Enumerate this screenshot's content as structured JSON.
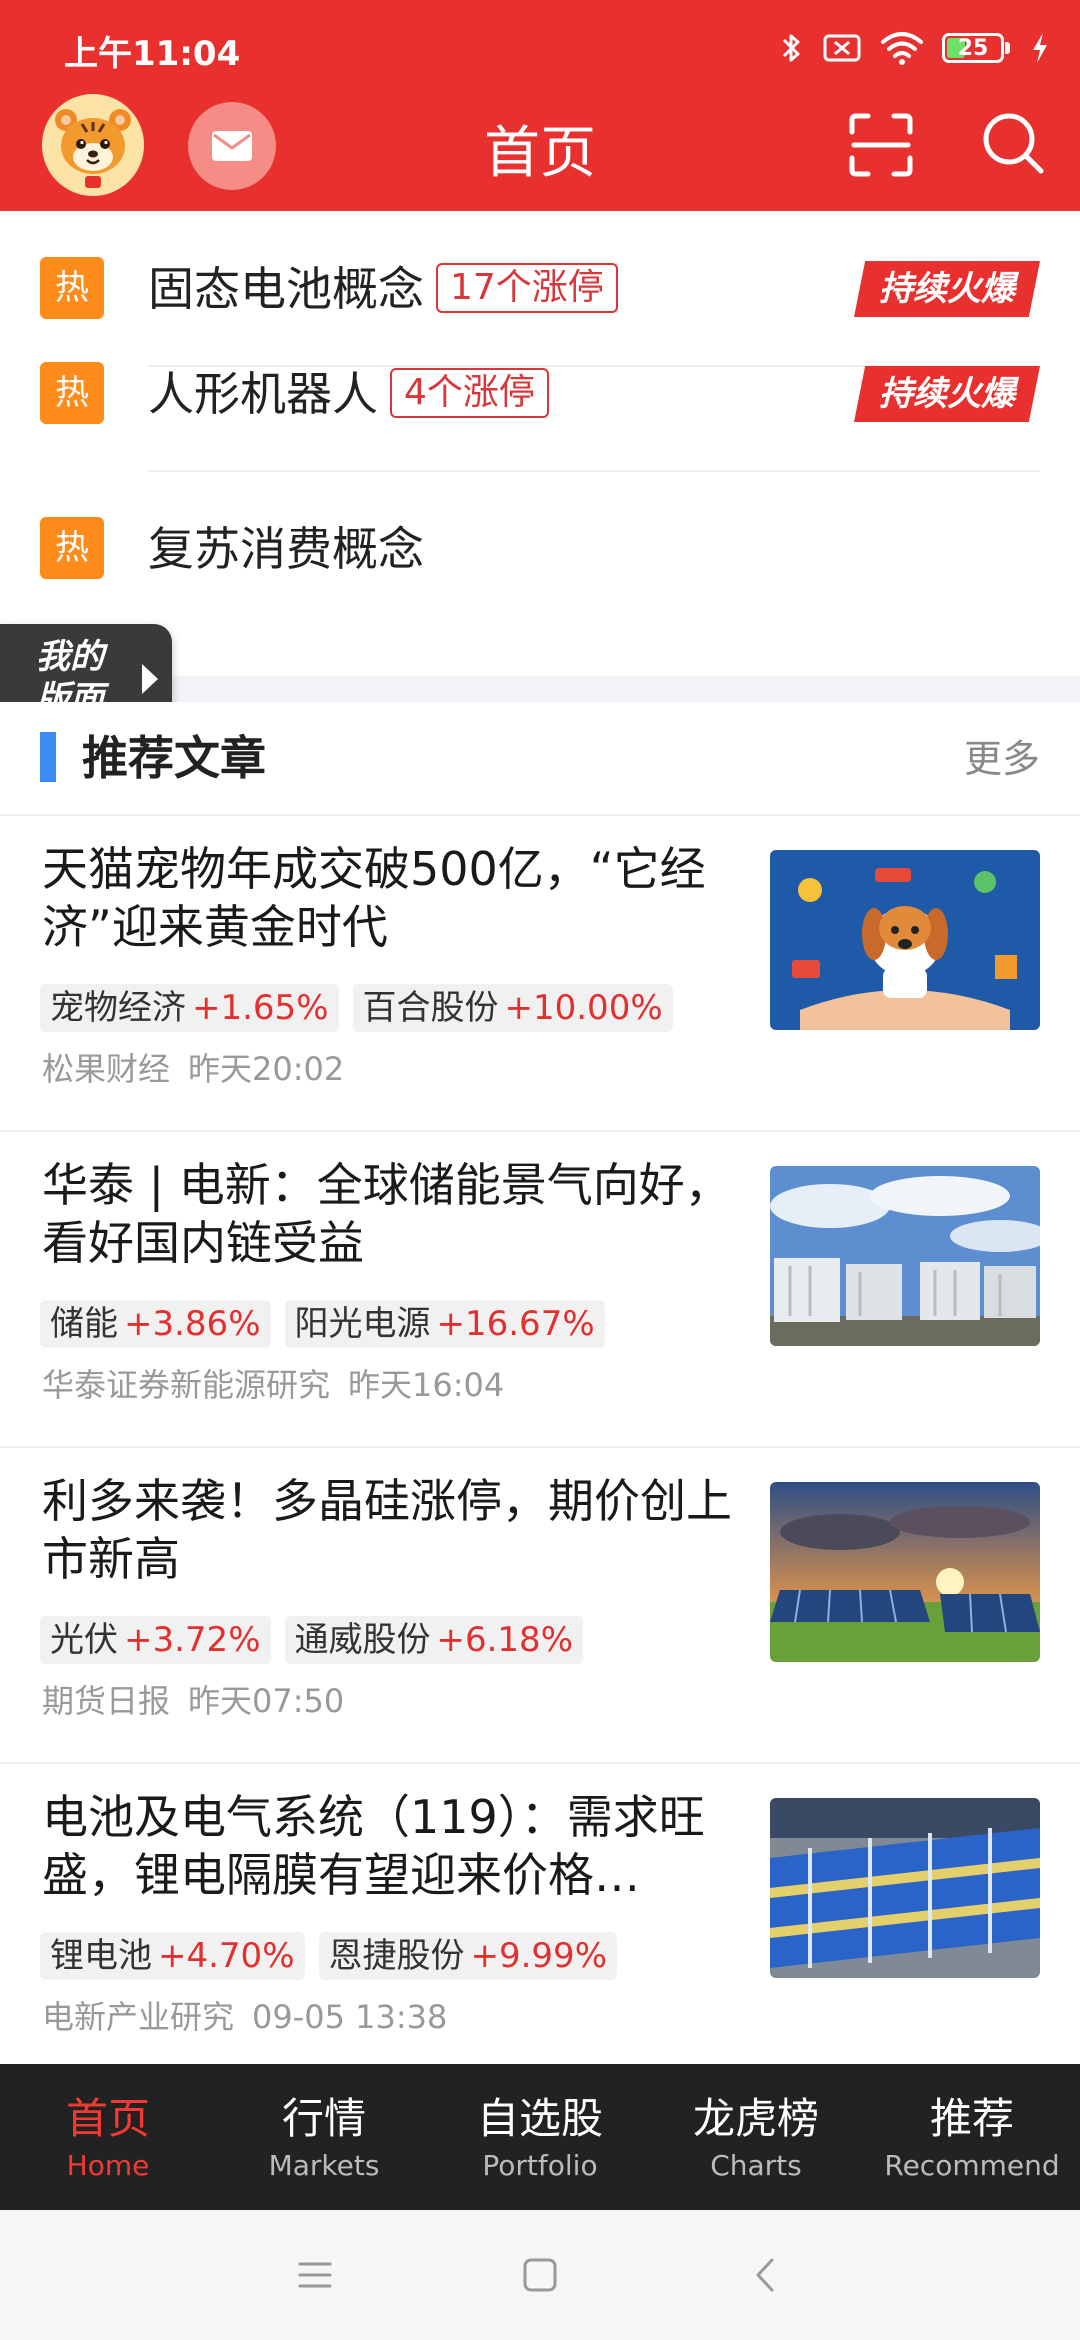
{
  "status_bar": {
    "time": "上午11:04",
    "battery": "25"
  },
  "header": {
    "title": "首页"
  },
  "hot_topics": [
    {
      "badge": "热",
      "name": "固态电池概念",
      "tag": "17个涨停",
      "fire_label": "持续火爆"
    },
    {
      "badge": "热",
      "name": "人形机器人",
      "tag": "4个涨停",
      "fire_label": "持续火爆"
    },
    {
      "badge": "热",
      "name": "复苏消费概念"
    }
  ],
  "my_board": {
    "label": "我的版面"
  },
  "recommend": {
    "title": "推荐文章",
    "more": "更多",
    "articles": [
      {
        "title": "天猫宠物年成交破500亿，“它经济”迎来黄金时代",
        "tags": [
          {
            "name": "宠物经济",
            "change": "+1.65%"
          },
          {
            "name": "百合股份",
            "change": "+10.00%"
          }
        ],
        "source": "松果财经",
        "time": "昨天20:02"
      },
      {
        "title": "华泰 | 电新：全球储能景气向好，看好国内链受益",
        "tags": [
          {
            "name": "储能",
            "change": "+3.86%"
          },
          {
            "name": "阳光电源",
            "change": "+16.67%"
          }
        ],
        "source": "华泰证券新能源研究",
        "time": "昨天16:04"
      },
      {
        "title": "利多来袭！多晶硅涨停，期价创上市新高",
        "tags": [
          {
            "name": "光伏",
            "change": "+3.72%"
          },
          {
            "name": "通威股份",
            "change": "+6.18%"
          }
        ],
        "source": "期货日报",
        "time": "昨天07:50"
      },
      {
        "title": "电池及电气系统（119）：需求旺盛，锂电隔膜有望迎来价格…",
        "tags": [
          {
            "name": "锂电池",
            "change": "+4.70%"
          },
          {
            "name": "恩捷股份",
            "change": "+9.99%"
          }
        ],
        "source": "电新产业研究",
        "time": "09-05 13:38"
      }
    ]
  },
  "tabs": [
    {
      "zh": "首页",
      "en": "Home",
      "active": true
    },
    {
      "zh": "行情",
      "en": "Markets"
    },
    {
      "zh": "自选股",
      "en": "Portfolio"
    },
    {
      "zh": "龙虎榜",
      "en": "Charts"
    },
    {
      "zh": "推荐",
      "en": "Recommend"
    }
  ],
  "colors": {
    "brand_red": "#e8302f",
    "hot_orange": "#ff8c1a",
    "accent_blue": "#3b8cf5",
    "up_red": "#e2302f",
    "tabbar_bg": "#222222"
  },
  "icons": [
    "bluetooth-icon",
    "sim-off-icon",
    "wifi-icon",
    "battery-icon",
    "charging-icon",
    "mail-icon",
    "scan-icon",
    "search-icon",
    "menu-icon",
    "home-square-icon",
    "back-icon"
  ]
}
